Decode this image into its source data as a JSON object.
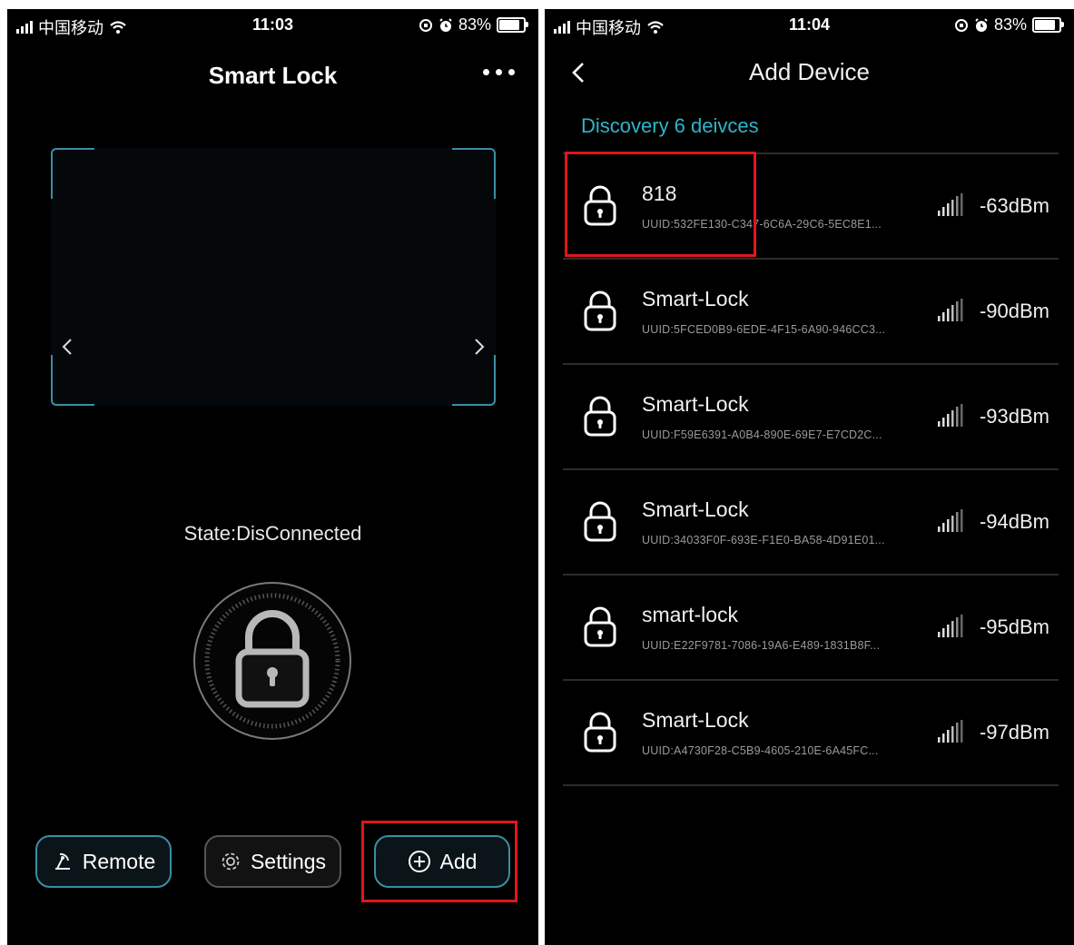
{
  "left_screen": {
    "status": {
      "carrier": "中国移动",
      "time": "11:03",
      "battery": "83%"
    },
    "title": "Smart Lock",
    "state_text": "State:DisConnected",
    "buttons": {
      "remote": "Remote",
      "settings": "Settings",
      "add": "Add"
    }
  },
  "right_screen": {
    "status": {
      "carrier": "中国移动",
      "time": "11:04",
      "battery": "83%"
    },
    "title": "Add Device",
    "discovery_text": "Discovery 6 deivces",
    "devices": [
      {
        "name": "818",
        "uuid": "UUID:532FE130-C347-6C6A-29C6-5EC8E1...",
        "rssi": "-63dBm"
      },
      {
        "name": "Smart-Lock",
        "uuid": "UUID:5FCED0B9-6EDE-4F15-6A90-946CC3...",
        "rssi": "-90dBm"
      },
      {
        "name": "Smart-Lock",
        "uuid": "UUID:F59E6391-A0B4-890E-69E7-E7CD2C...",
        "rssi": "-93dBm"
      },
      {
        "name": "Smart-Lock",
        "uuid": "UUID:34033F0F-693E-F1E0-BA58-4D91E01...",
        "rssi": "-94dBm"
      },
      {
        "name": "smart-lock",
        "uuid": "UUID:E22F9781-7086-19A6-E489-1831B8F...",
        "rssi": "-95dBm"
      },
      {
        "name": "Smart-Lock",
        "uuid": "UUID:A4730F28-C5B9-4605-210E-6A45FC...",
        "rssi": "-97dBm"
      }
    ]
  },
  "colors": {
    "accent": "#2fb5c8",
    "frame": "#3b8ea3",
    "highlight": "#e0161b",
    "background": "#000000"
  },
  "icons": [
    "signal-icon",
    "wifi-icon",
    "lock-rotation-icon",
    "alarm-icon",
    "battery-icon",
    "more-icon",
    "chevron-left-icon",
    "chevron-right-icon",
    "padlock-icon",
    "remote-icon",
    "gear-icon",
    "plus-circle-icon",
    "back-icon",
    "rssi-bars-icon"
  ]
}
